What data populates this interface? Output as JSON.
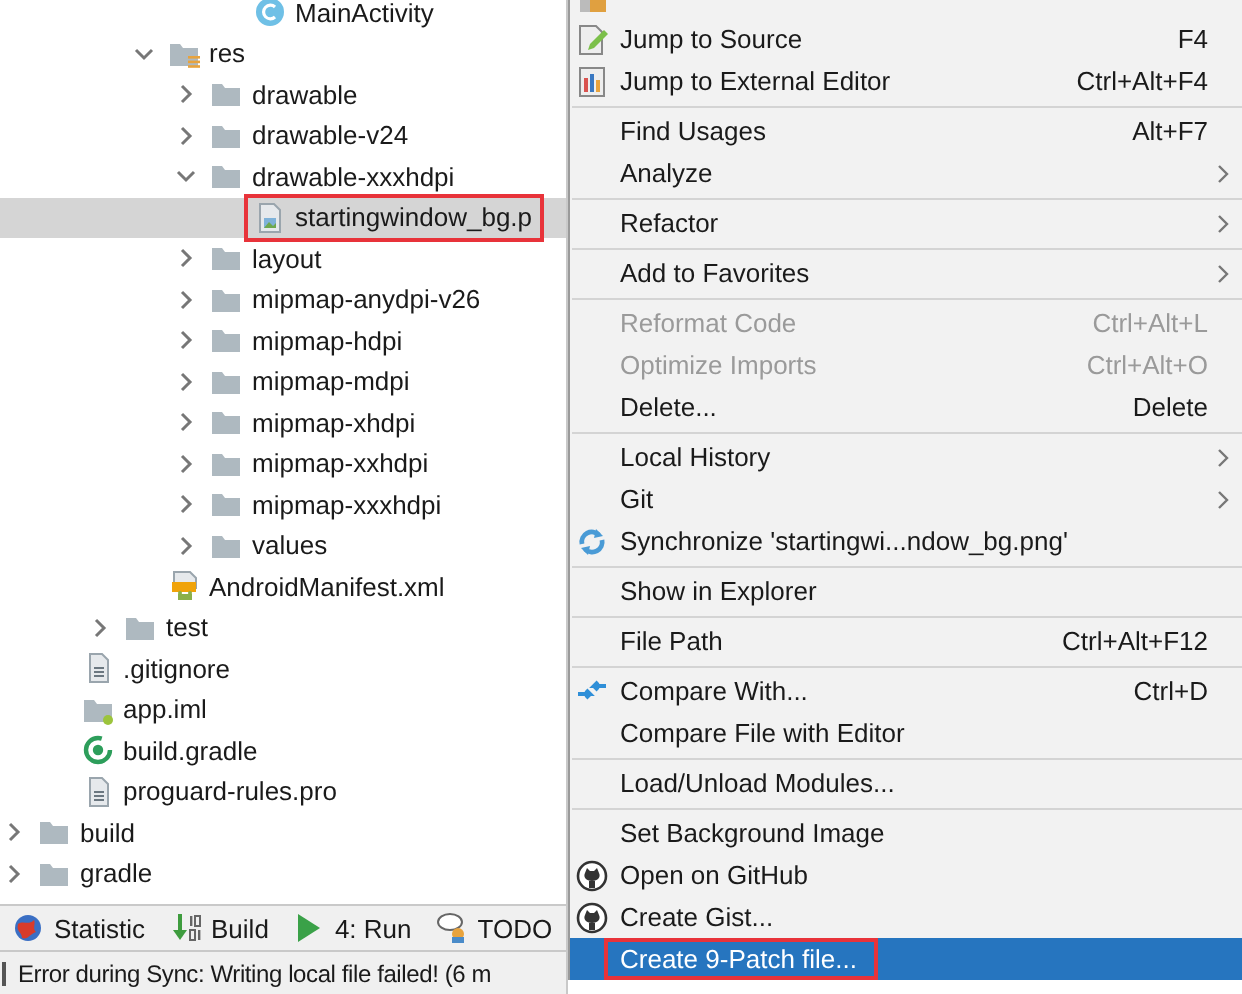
{
  "project_tree": {
    "items": [
      {
        "children": [
          {
            "children": [
              {
                "children": [
                  {
                    "children": [
                      {
                        "children": [
                          {
                            "label": "MainActivity",
                            "kind": "class",
                            "selected": false,
                            "annotated": false
                          }
                        ]
                      }
                    ]
                  },
                  {
                    "label": "res",
                    "kind": "res-folder",
                    "expanded": true,
                    "selected": false,
                    "annotated": false,
                    "children": [
                      {
                        "label": "drawable",
                        "kind": "folder",
                        "expanded": false,
                        "selected": false,
                        "annotated": false
                      },
                      {
                        "label": "drawable-v24",
                        "kind": "folder",
                        "expanded": false,
                        "selected": false,
                        "annotated": false
                      },
                      {
                        "label": "drawable-xxxhdpi",
                        "kind": "folder",
                        "expanded": true,
                        "selected": false,
                        "annotated": false,
                        "children": [
                          {
                            "label": "startingwindow_bg.p",
                            "kind": "image",
                            "selected": true,
                            "annotated": true
                          }
                        ]
                      },
                      {
                        "label": "layout",
                        "kind": "folder",
                        "expanded": false,
                        "selected": false,
                        "annotated": false
                      },
                      {
                        "label": "mipmap-anydpi-v26",
                        "kind": "folder",
                        "expanded": false,
                        "selected": false,
                        "annotated": false
                      },
                      {
                        "label": "mipmap-hdpi",
                        "kind": "folder",
                        "expanded": false,
                        "selected": false,
                        "annotated": false
                      },
                      {
                        "label": "mipmap-mdpi",
                        "kind": "folder",
                        "expanded": false,
                        "selected": false,
                        "annotated": false
                      },
                      {
                        "label": "mipmap-xhdpi",
                        "kind": "folder",
                        "expanded": false,
                        "selected": false,
                        "annotated": false
                      },
                      {
                        "label": "mipmap-xxhdpi",
                        "kind": "folder",
                        "expanded": false,
                        "selected": false,
                        "annotated": false
                      },
                      {
                        "label": "mipmap-xxxhdpi",
                        "kind": "folder",
                        "expanded": false,
                        "selected": false,
                        "annotated": false
                      },
                      {
                        "label": "values",
                        "kind": "folder",
                        "expanded": false,
                        "selected": false,
                        "annotated": false
                      }
                    ]
                  },
                  {
                    "label": "AndroidManifest.xml",
                    "kind": "manifest",
                    "selected": false,
                    "annotated": false
                  }
                ]
              },
              {
                "label": "test",
                "kind": "folder",
                "expanded": false,
                "selected": false,
                "annotated": false
              }
            ]
          },
          {
            "label": ".gitignore",
            "kind": "text",
            "selected": false,
            "annotated": false
          },
          {
            "label": "app.iml",
            "kind": "module",
            "selected": false,
            "annotated": false
          },
          {
            "label": "build.gradle",
            "kind": "gradle",
            "selected": false,
            "annotated": false
          },
          {
            "label": "proguard-rules.pro",
            "kind": "text",
            "selected": false,
            "annotated": false
          }
        ]
      },
      {
        "label": "build",
        "kind": "folder",
        "expanded": false,
        "selected": false,
        "annotated": false
      },
      {
        "label": "gradle",
        "kind": "folder",
        "expanded": false,
        "selected": false,
        "annotated": false
      }
    ]
  },
  "tool_windows": [
    {
      "label": "Statistic"
    },
    {
      "label": "Build"
    },
    {
      "label": "4: Run"
    },
    {
      "label": "TODO"
    }
  ],
  "status_bar": {
    "message": "Error during Sync: Writing local file failed! (6 m"
  },
  "context_menu": {
    "items": [
      {
        "kind": "item",
        "submenu": false,
        "disabled": false,
        "selected": false,
        "annotated": false
      },
      {
        "kind": "item",
        "label": "Jump to Source",
        "shortcut": "F4",
        "submenu": false,
        "disabled": false,
        "selected": false,
        "annotated": false
      },
      {
        "kind": "item",
        "label": "Jump to External Editor",
        "shortcut": "Ctrl+Alt+F4",
        "submenu": false,
        "disabled": false,
        "selected": false,
        "annotated": false
      },
      {
        "kind": "separator"
      },
      {
        "kind": "item",
        "label": "Find Usages",
        "shortcut": "Alt+F7",
        "submenu": false,
        "disabled": false,
        "selected": false,
        "annotated": false
      },
      {
        "kind": "item",
        "label": "Analyze",
        "submenu": true,
        "disabled": false,
        "selected": false,
        "annotated": false
      },
      {
        "kind": "separator"
      },
      {
        "kind": "item",
        "label": "Refactor",
        "submenu": true,
        "disabled": false,
        "selected": false,
        "annotated": false
      },
      {
        "kind": "separator"
      },
      {
        "kind": "item",
        "label": "Add to Favorites",
        "submenu": true,
        "disabled": false,
        "selected": false,
        "annotated": false
      },
      {
        "kind": "separator"
      },
      {
        "kind": "item",
        "label": "Reformat Code",
        "shortcut": "Ctrl+Alt+L",
        "submenu": false,
        "disabled": true,
        "selected": false,
        "annotated": false
      },
      {
        "kind": "item",
        "label": "Optimize Imports",
        "shortcut": "Ctrl+Alt+O",
        "submenu": false,
        "disabled": true,
        "selected": false,
        "annotated": false
      },
      {
        "kind": "item",
        "label": "Delete...",
        "shortcut": "Delete",
        "submenu": false,
        "disabled": false,
        "selected": false,
        "annotated": false
      },
      {
        "kind": "separator"
      },
      {
        "kind": "item",
        "label": "Local History",
        "submenu": true,
        "disabled": false,
        "selected": false,
        "annotated": false
      },
      {
        "kind": "item",
        "label": "Git",
        "submenu": true,
        "disabled": false,
        "selected": false,
        "annotated": false
      },
      {
        "kind": "item",
        "label": "Synchronize 'startingwi...ndow_bg.png'",
        "submenu": false,
        "disabled": false,
        "selected": false,
        "annotated": false
      },
      {
        "kind": "separator"
      },
      {
        "kind": "item",
        "label": "Show in Explorer",
        "submenu": false,
        "disabled": false,
        "selected": false,
        "annotated": false
      },
      {
        "kind": "separator"
      },
      {
        "kind": "item",
        "label": "File Path",
        "shortcut": "Ctrl+Alt+F12",
        "submenu": false,
        "disabled": false,
        "selected": false,
        "annotated": false
      },
      {
        "kind": "separator"
      },
      {
        "kind": "item",
        "label": "Compare With...",
        "shortcut": "Ctrl+D",
        "submenu": false,
        "disabled": false,
        "selected": false,
        "annotated": false
      },
      {
        "kind": "item",
        "label": "Compare File with Editor",
        "submenu": false,
        "disabled": false,
        "selected": false,
        "annotated": false
      },
      {
        "kind": "separator"
      },
      {
        "kind": "item",
        "label": "Load/Unload Modules...",
        "submenu": false,
        "disabled": false,
        "selected": false,
        "annotated": false
      },
      {
        "kind": "separator"
      },
      {
        "kind": "item",
        "label": "Set Background Image",
        "submenu": false,
        "disabled": false,
        "selected": false,
        "annotated": false
      },
      {
        "kind": "item",
        "label": "Open on GitHub",
        "submenu": false,
        "disabled": false,
        "selected": false,
        "annotated": false
      },
      {
        "kind": "item",
        "label": "Create Gist...",
        "submenu": false,
        "disabled": false,
        "selected": false,
        "annotated": false
      },
      {
        "kind": "item",
        "label": "Create 9-Patch file...",
        "submenu": false,
        "disabled": false,
        "selected": true,
        "annotated": true
      }
    ]
  }
}
